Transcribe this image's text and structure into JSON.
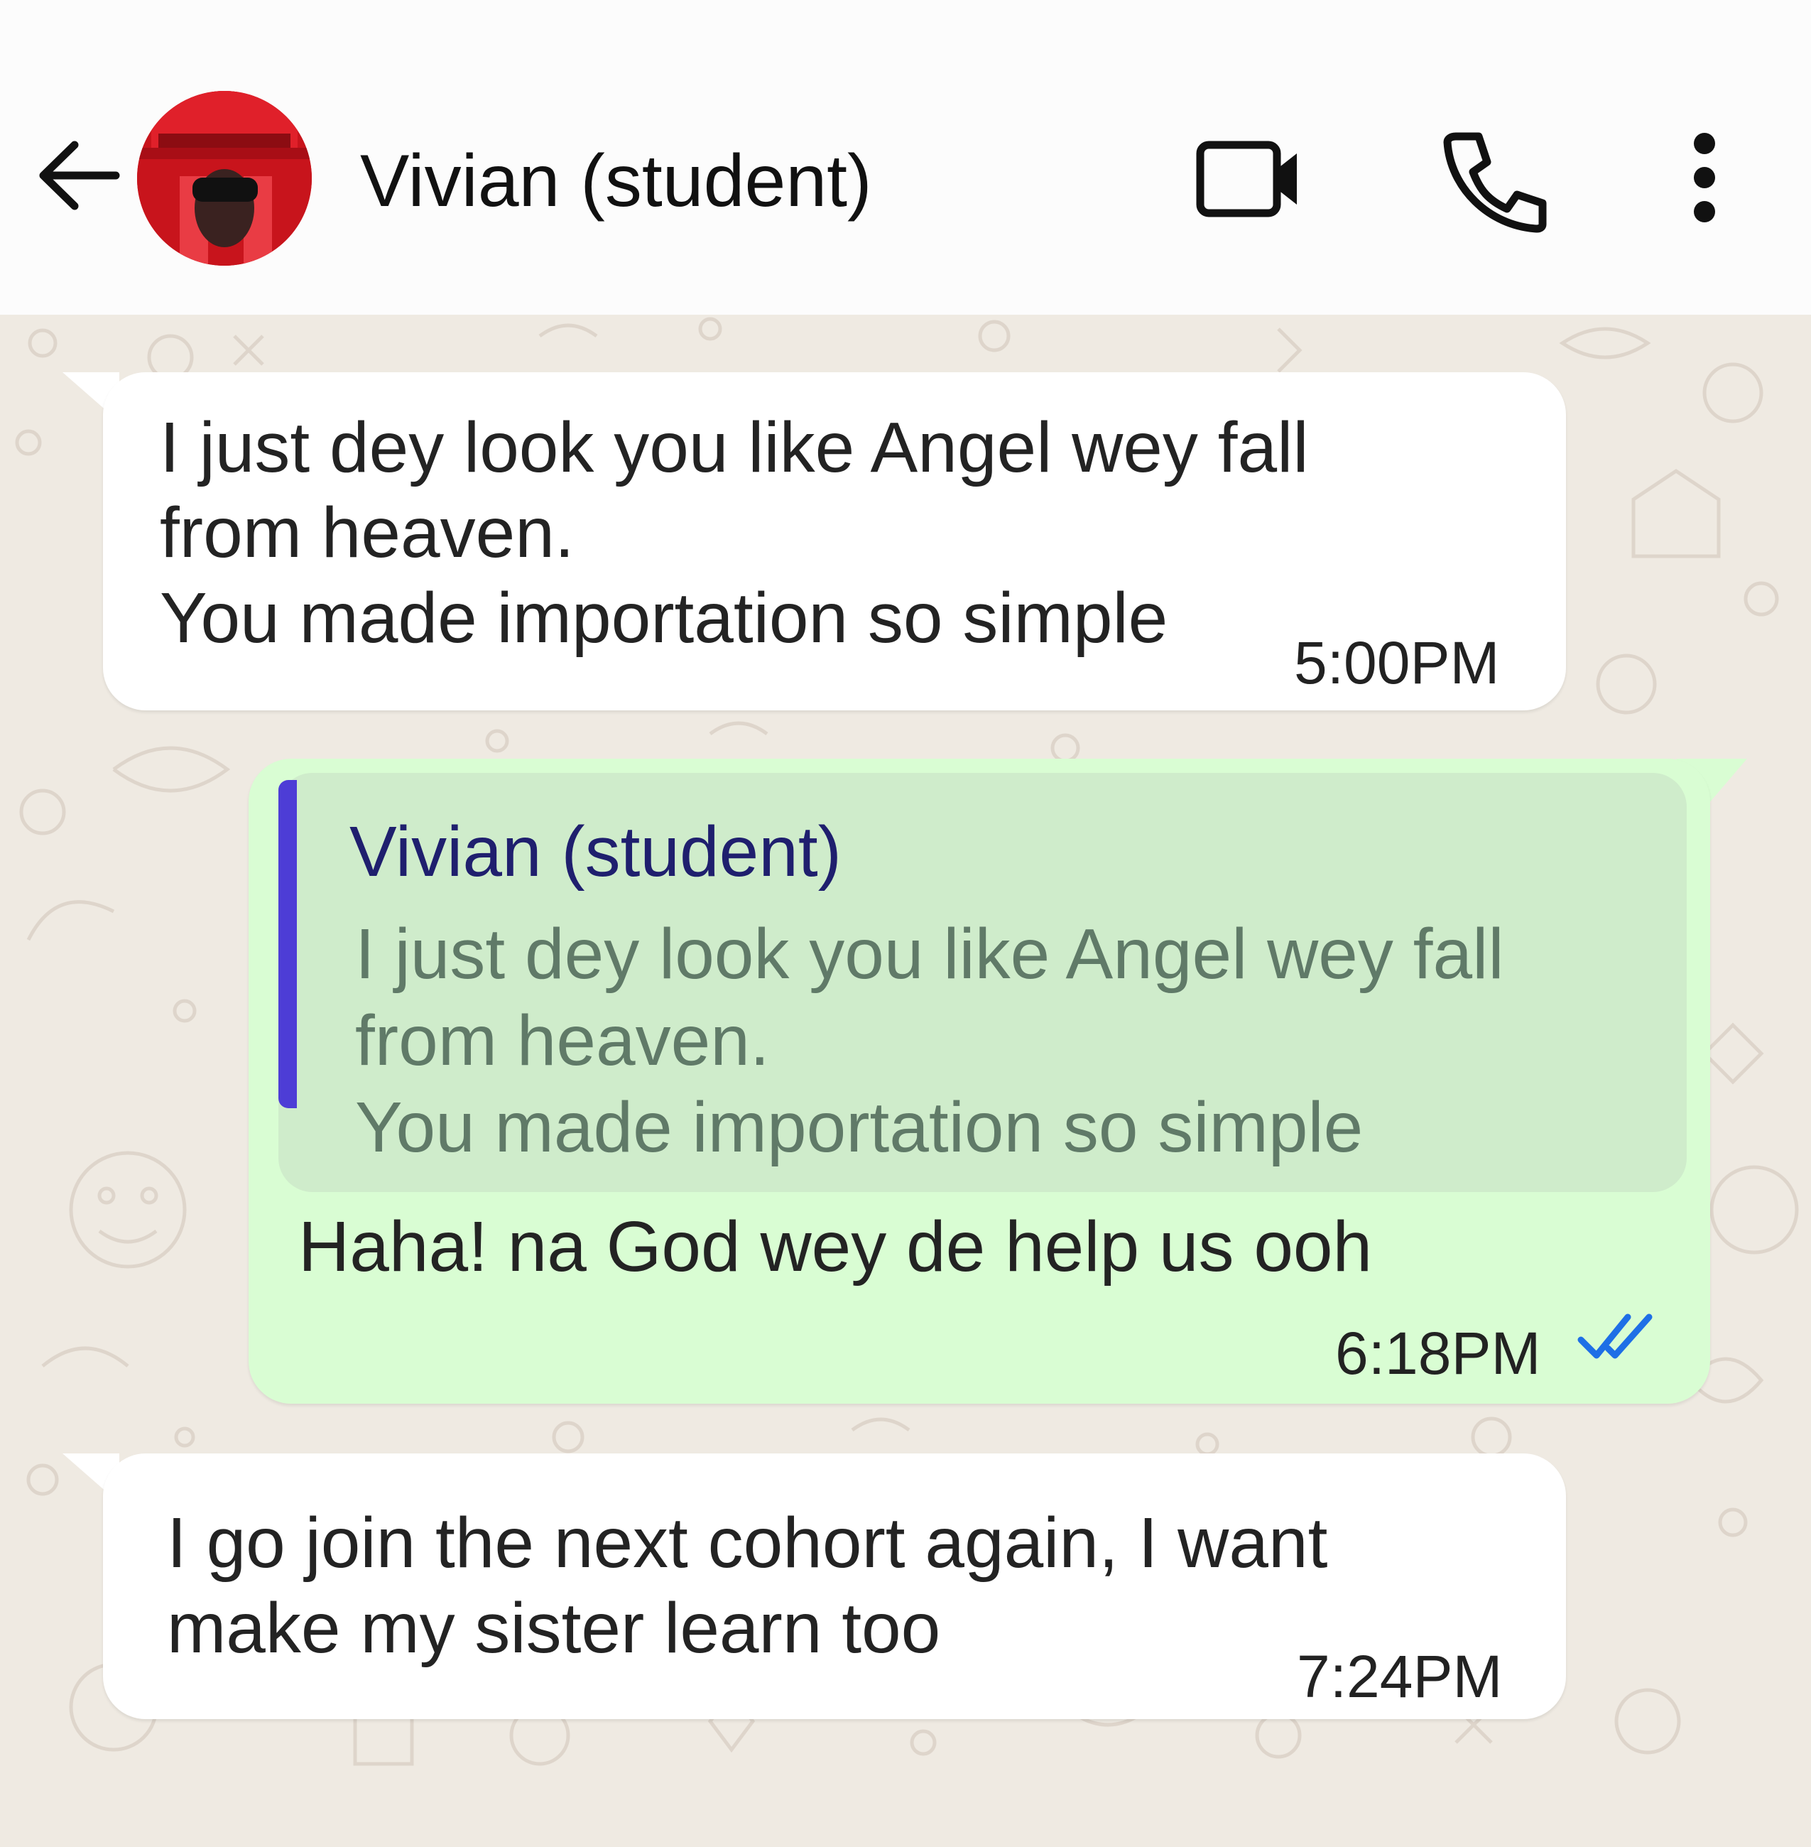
{
  "header": {
    "contact_name": "Vivian (student)"
  },
  "messages": [
    {
      "direction": "incoming",
      "text": "I just dey look you like Angel wey fall\nfrom heaven.\nYou made importation so simple",
      "time": "5:00PM"
    },
    {
      "direction": "outgoing",
      "quoted": {
        "author": "Vivian (student)",
        "text": "I just dey look you like Angel wey fall\nfrom heaven.\nYou made importation so simple"
      },
      "text": "Haha! na God wey de help us ooh",
      "time": "6:18PM",
      "read_status": "double-check-read-icon"
    },
    {
      "direction": "incoming",
      "text": "I go join the next cohort again, I want\nmake my sister learn too",
      "time": "7:24PM"
    }
  ],
  "colors": {
    "incoming_bubble": "#ffffff",
    "outgoing_bubble": "#d9fdd3",
    "quote_bar": "#4d3dd6",
    "quote_author": "#1f1f6e",
    "read_ticks": "#1e6fe6",
    "chat_background": "#efeae2"
  },
  "icons": {
    "back": "arrow-left-icon",
    "video_call": "video-camera-icon",
    "voice_call": "phone-icon",
    "menu": "more-vertical-icon"
  }
}
